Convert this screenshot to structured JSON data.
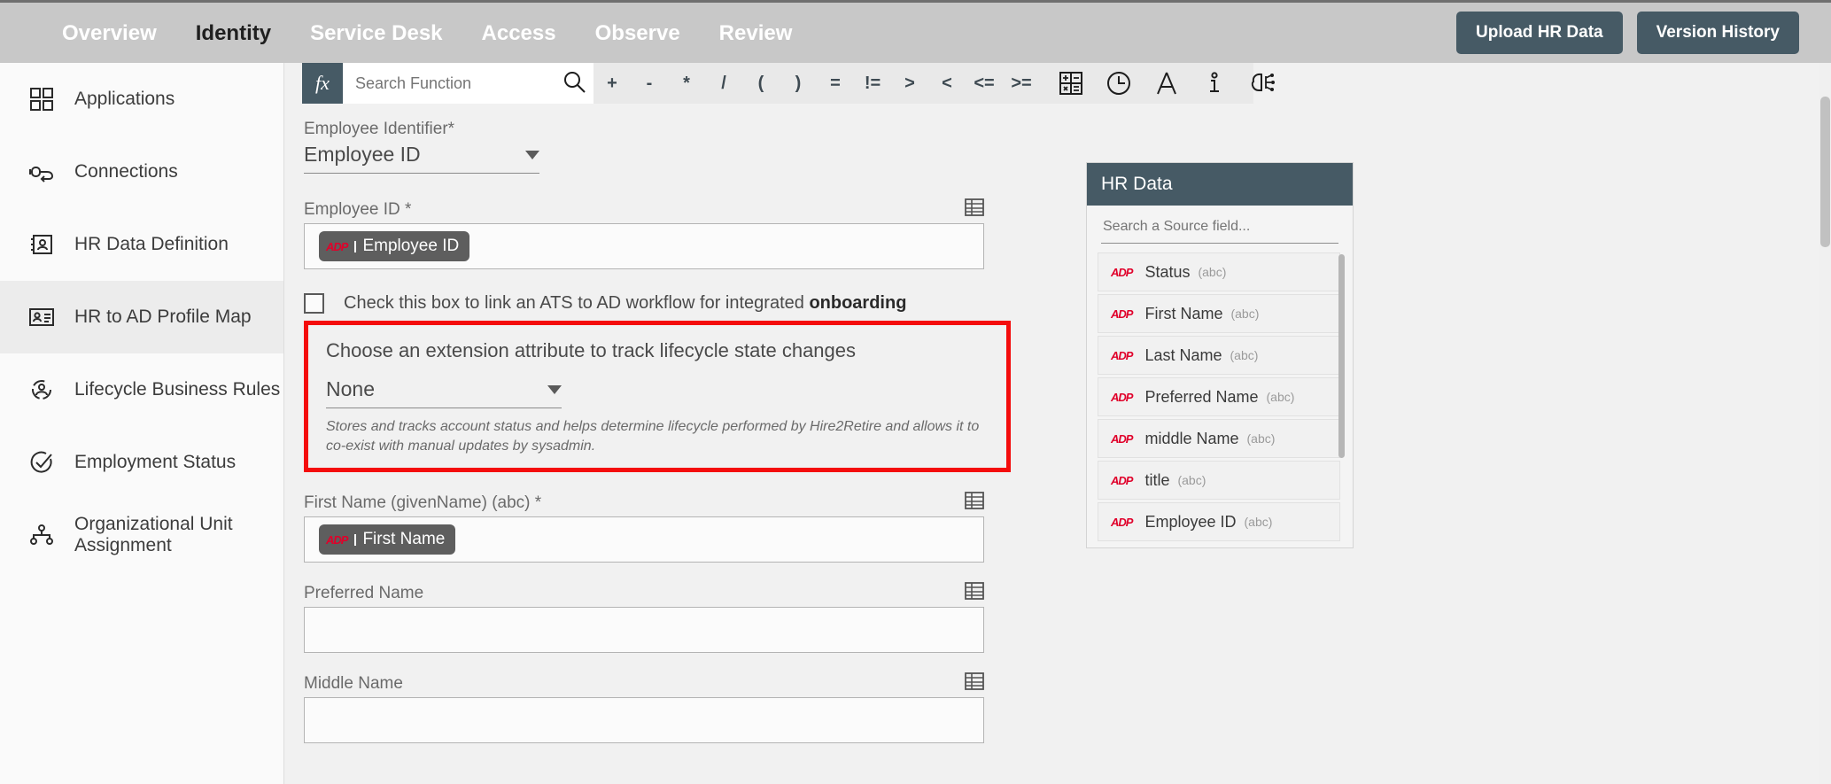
{
  "topbar": {
    "nav": [
      {
        "label": "Overview",
        "active": false
      },
      {
        "label": "Identity",
        "active": true
      },
      {
        "label": "Service Desk",
        "active": false
      },
      {
        "label": "Access",
        "active": false
      },
      {
        "label": "Observe",
        "active": false
      },
      {
        "label": "Review",
        "active": false
      }
    ],
    "upload_button": "Upload HR Data",
    "version_button": "Version History",
    "bg_color": "#c8c8c8",
    "button_color": "#465a65"
  },
  "sidebar": {
    "items": [
      {
        "label": "Applications",
        "icon": "grid-icon",
        "selected": false
      },
      {
        "label": "Connections",
        "icon": "plug-icon",
        "selected": false
      },
      {
        "label": "HR Data Definition",
        "icon": "contact-card-icon",
        "selected": false
      },
      {
        "label": "HR to AD Profile Map",
        "icon": "id-badge-icon",
        "selected": true
      },
      {
        "label": "Lifecycle Business Rules",
        "icon": "user-cycle-icon",
        "selected": false
      },
      {
        "label": "Employment Status",
        "icon": "check-circle-icon",
        "selected": false
      },
      {
        "label": "Organizational Unit Assignment",
        "icon": "org-tree-icon",
        "selected": false
      }
    ]
  },
  "toolbar": {
    "fx_label": "fx",
    "search_placeholder": "Search Function",
    "search_value": "",
    "search_icon": "search-icon",
    "operators": [
      "+",
      "-",
      "*",
      "/",
      "(",
      ")",
      "=",
      "!=",
      ">",
      "<",
      "<=",
      ">="
    ],
    "icons": [
      "calculator-icon",
      "clock-icon",
      "text-icon",
      "info-icon",
      "ai-brain-icon"
    ]
  },
  "form": {
    "employee_identifier": {
      "label": "Employee Identifier*",
      "value": "Employee ID"
    },
    "employee_id": {
      "label": "Employee ID *",
      "chip": "Employee ID",
      "chip_logo": "ADP",
      "grid_icon": "table-icon"
    },
    "ats_checkbox": {
      "checked": false,
      "text_normal": "Check this box to link an ATS to AD workflow for integrated ",
      "text_bold": "onboarding"
    },
    "extension_attribute": {
      "highlight_color": "#f40c0c",
      "title": "Choose an extension attribute to track lifecycle state changes",
      "value": "None",
      "helper": "Stores and tracks account status and helps determine lifecycle performed by Hire2Retire and allows it to co-exist with manual updates by sysadmin."
    },
    "first_name": {
      "label": "First Name (givenName) (abc) *",
      "chip": "First Name",
      "chip_logo": "ADP",
      "grid_icon": "table-icon"
    },
    "preferred_name": {
      "label": "Preferred Name",
      "value": "",
      "grid_icon": "table-icon"
    },
    "middle_name": {
      "label": "Middle Name",
      "value": "",
      "grid_icon": "table-icon"
    }
  },
  "hr_panel": {
    "title": "HR Data",
    "search_placeholder": "Search a Source field...",
    "search_value": "",
    "header_color": "#465a65",
    "fields": [
      {
        "name": "Status",
        "type": "(abc)",
        "logo": "ADP"
      },
      {
        "name": "First Name",
        "type": "(abc)",
        "logo": "ADP"
      },
      {
        "name": "Last Name",
        "type": "(abc)",
        "logo": "ADP"
      },
      {
        "name": "Preferred Name",
        "type": "(abc)",
        "logo": "ADP"
      },
      {
        "name": "middle Name",
        "type": "(abc)",
        "logo": "ADP"
      },
      {
        "name": "title",
        "type": "(abc)",
        "logo": "ADP"
      },
      {
        "name": "Employee ID",
        "type": "(abc)",
        "logo": "ADP"
      }
    ]
  }
}
